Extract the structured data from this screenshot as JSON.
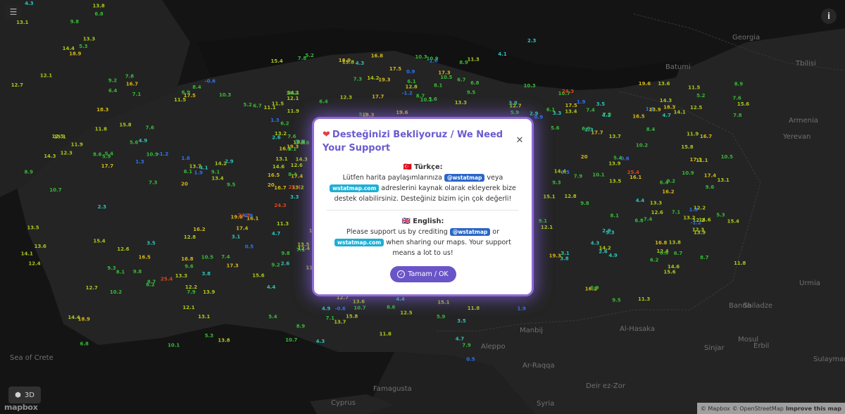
{
  "map": {
    "place_labels": [
      "Georgia",
      "Tbilisi",
      "Armenia",
      "Yerevan",
      "Urmia",
      "Banda",
      "Shiladze",
      "Mosul",
      "Erbil",
      "Sulaymaniyah",
      "Aleppo",
      "Al-Hasaka",
      "Ar-Raqqa",
      "Deir ez-Zor",
      "Sinjar",
      "Syria",
      "Cyprus",
      "Famagusta",
      "Manbij",
      "Batumi",
      "Sea of Crete"
    ],
    "station_values": [
      "18.9",
      "13.1",
      "14.4",
      "12.7",
      "13.3",
      "12.1",
      "13.8",
      "9.8",
      "6.8",
      "5.3",
      "4.3",
      "7.1",
      "8.9",
      "11.8",
      "10.7",
      "11.9",
      "12.4",
      "12.5",
      "12.3",
      "13.5",
      "14.3",
      "14.1",
      "13.6",
      "15.1",
      "14.2",
      "16.1",
      "15.8",
      "17.5",
      "17.7",
      "19.6",
      "19.3",
      "20",
      "16.8",
      "6.1",
      "7.6",
      "5.2",
      "3.5",
      "4.4",
      "2.6",
      "0.9",
      "-0.6",
      "-1.2",
      "1.3",
      "3.1",
      "6.2",
      "8.6",
      "9.1",
      "10.2",
      "9.6",
      "13.4",
      "12.6",
      "13.2",
      "18.3",
      "17.4",
      "17.3",
      "16.5",
      "16.7",
      "9.2",
      "10.5",
      "11.1",
      "8.4",
      "7.3",
      "5.4",
      "4.9",
      "6.7",
      "7.8",
      "10.3",
      "11.5",
      "13.7",
      "15.4",
      "12.8",
      "25.4",
      "24.3",
      "10.9",
      "9.3",
      "6.4",
      "5.6",
      "2.3",
      "1.6",
      "3.8",
      "4.1",
      "8.1",
      "9.5",
      "11.3",
      "12.2",
      "14.6",
      "16.2",
      "15.6",
      "13.9",
      "7.4",
      "6.9",
      "3.3",
      "2.9",
      "0.5",
      "1.9",
      "4.7",
      "5.9",
      "7.9",
      "8.7",
      "10.1"
    ]
  },
  "controls": {
    "menu_icon": "menu-icon",
    "info_icon": "info-icon",
    "three_d_label": "3D",
    "mapbox_logo_text": "mapbox"
  },
  "attribution": {
    "mapbox": "© Mapbox",
    "osm": "© OpenStreetMap",
    "improve": "Improve this map"
  },
  "modal": {
    "title": "Desteğinizi Bekliyoruz / We Need Your Support",
    "tr": {
      "heading": "Türkçe:",
      "text_before": "Lütfen harita paylaşımlarınıza",
      "badge1": "@wstatmap",
      "text_middle": "veya",
      "badge2": "wstatmap.com",
      "text_after": "adreslerini kaynak olarak ekleyerek bize destek olabilirsiniz. Desteğiniz bizim için çok değerli!"
    },
    "en": {
      "heading": "English:",
      "text_before": "Please support us by crediting",
      "badge1": "@wstatmap",
      "text_middle": "or",
      "badge2": "wstatmap.com",
      "text_after": "when sharing our maps. Your support means a lot to us!"
    },
    "ok_label": "Tamam / OK"
  },
  "colors": {
    "modal_accent": "#6a55c8",
    "badge_blue": "#2a66c7",
    "badge_cyan": "#1eaed6",
    "heart": "#e33b4b",
    "temp_cold": "#2f7bff",
    "temp_cool": "#2fd0c0",
    "temp_mild": "#39c43a",
    "temp_warm": "#b5d31c",
    "temp_hot": "#e0c21a",
    "temp_very_hot": "#e84a1a"
  }
}
